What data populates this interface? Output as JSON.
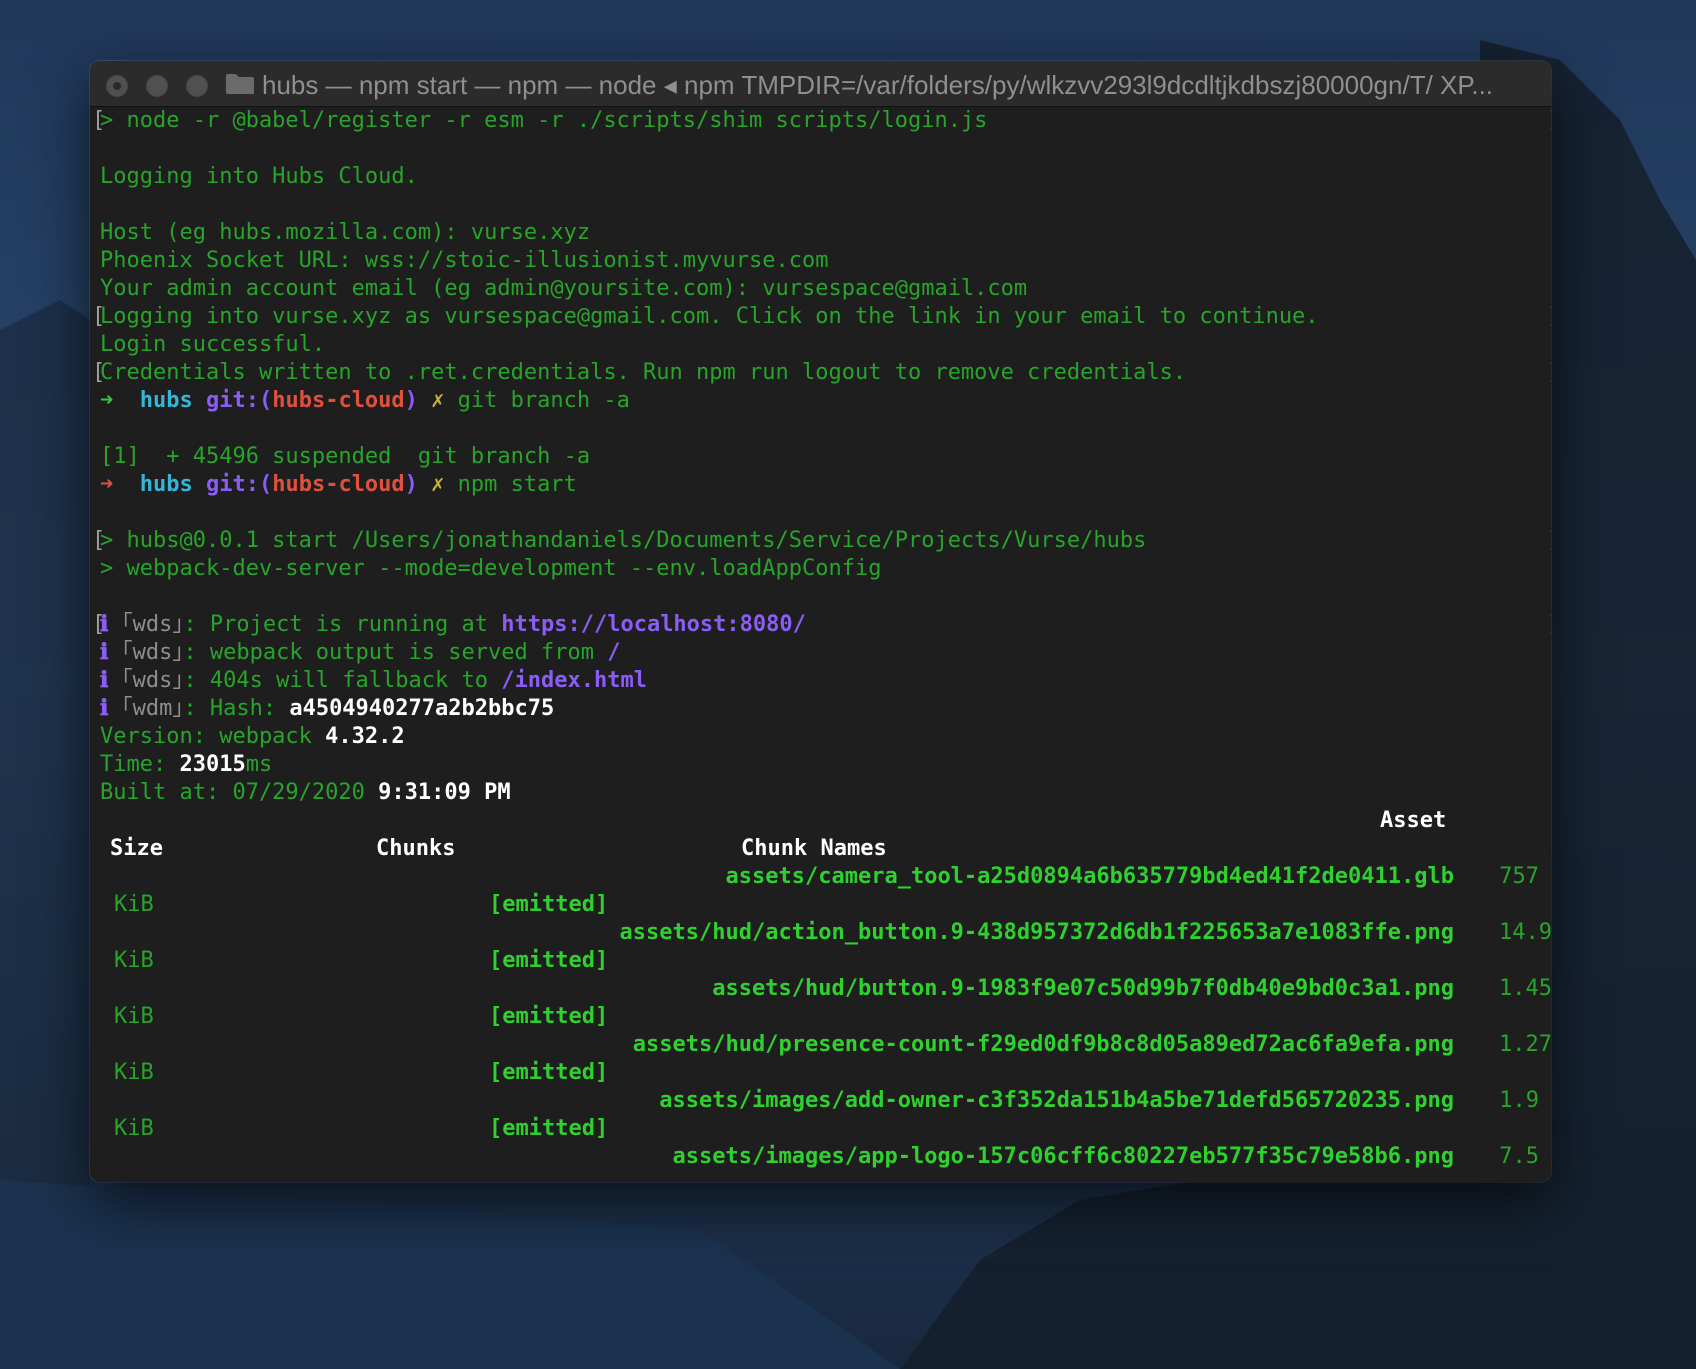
{
  "window": {
    "title": "hubs — npm start — npm — node ◂ npm TMPDIR=/var/folders/py/wlkzvv293l9dcdltjkdbszj80000gn/T/ XP..."
  },
  "terminal": {
    "l01": "> node -r @babel/register -r esm -r ./scripts/shim scripts/login.js",
    "l03": "Logging into Hubs Cloud.",
    "l05": "Host (eg hubs.mozilla.com): vurse.xyz",
    "l06": "Phoenix Socket URL: wss://stoic-illusionist.myvurse.com",
    "l07": "Your admin account email (eg admin@yoursite.com): vursespace@gmail.com",
    "l08": "Logging into vurse.xyz as vursespace@gmail.com. Click on the link in your email to continue.",
    "l09": "Login successful.",
    "l10": "Credentials written to .ret.credentials. Run npm run logout to remove credentials.",
    "p1_arrow": "➜",
    "p1_dir": "hubs",
    "p1_git": "git:(",
    "p1_branch": "hubs-cloud",
    "p1_close": ")",
    "p1_x": "✗",
    "p1_cmd": "git branch -a",
    "l13": "[1]  + 45496 suspended  git branch -a",
    "p2_arrow": "➜",
    "p2_dir": "hubs",
    "p2_git": "git:(",
    "p2_branch": "hubs-cloud",
    "p2_close": ")",
    "p2_x": "✗",
    "p2_cmd": "npm start",
    "l16": "> hubs@0.0.1 start /Users/jonathandaniels/Documents/Service/Projects/Vurse/hubs",
    "l17": "> webpack-dev-server --mode=development --env.loadAppConfig",
    "info_icon": "ℹ",
    "wds_tag": "｢wds｣",
    "wdm_tag": "｢wdm｣",
    "l19_text": ": Project is running at ",
    "l19_url": "https://localhost:8080/",
    "l20_text": ": webpack output is served from ",
    "l20_path": "/",
    "l21_text": ": 404s will fallback to ",
    "l21_path": "/index.html",
    "l22_text": ": Hash: ",
    "l22_hash": "a4504940277a2b2bbc75",
    "l23_text": "Version: webpack ",
    "l23_ver": "4.32.2",
    "l24_text": "Time: ",
    "l24_num": "23015",
    "l24_unit": "ms",
    "l25_text": "Built at: 07/29/2020 ",
    "l25_time": "9:31:09 PM"
  },
  "assets_table": {
    "header_asset": "Asset",
    "header_size": "Size",
    "header_chunks": "Chunks",
    "header_chunk_names": "Chunk Names",
    "emitted_label": "[emitted]",
    "size_unit": "KiB",
    "rows": [
      {
        "asset": "assets/camera_tool-a25d0894a6b635779bd4ed41f2de0411.glb",
        "size": "757"
      },
      {
        "asset": "assets/hud/action_button.9-438d957372d6db1f225653a7e1083ffe.png",
        "size": "14.9"
      },
      {
        "asset": "assets/hud/button.9-1983f9e07c50d99b7f0db40e9bd0c3a1.png",
        "size": "1.45"
      },
      {
        "asset": "assets/hud/presence-count-f29ed0df9b8c8d05a89ed72ac6fa9efa.png",
        "size": "1.27"
      },
      {
        "asset": "assets/images/add-owner-c3f352da151b4a5be71defd565720235.png",
        "size": "1.9"
      },
      {
        "asset": "assets/images/app-logo-157c06cff6c80227eb577f35c79e58b6.png",
        "size": "7.5"
      }
    ]
  },
  "colors": {
    "terminal_bg": "#1e1e1e",
    "text_green": "#28a42b",
    "accent_purple": "#8b5cf6",
    "prompt_cyan": "#36b5d6",
    "branch_red": "#e0503f"
  }
}
